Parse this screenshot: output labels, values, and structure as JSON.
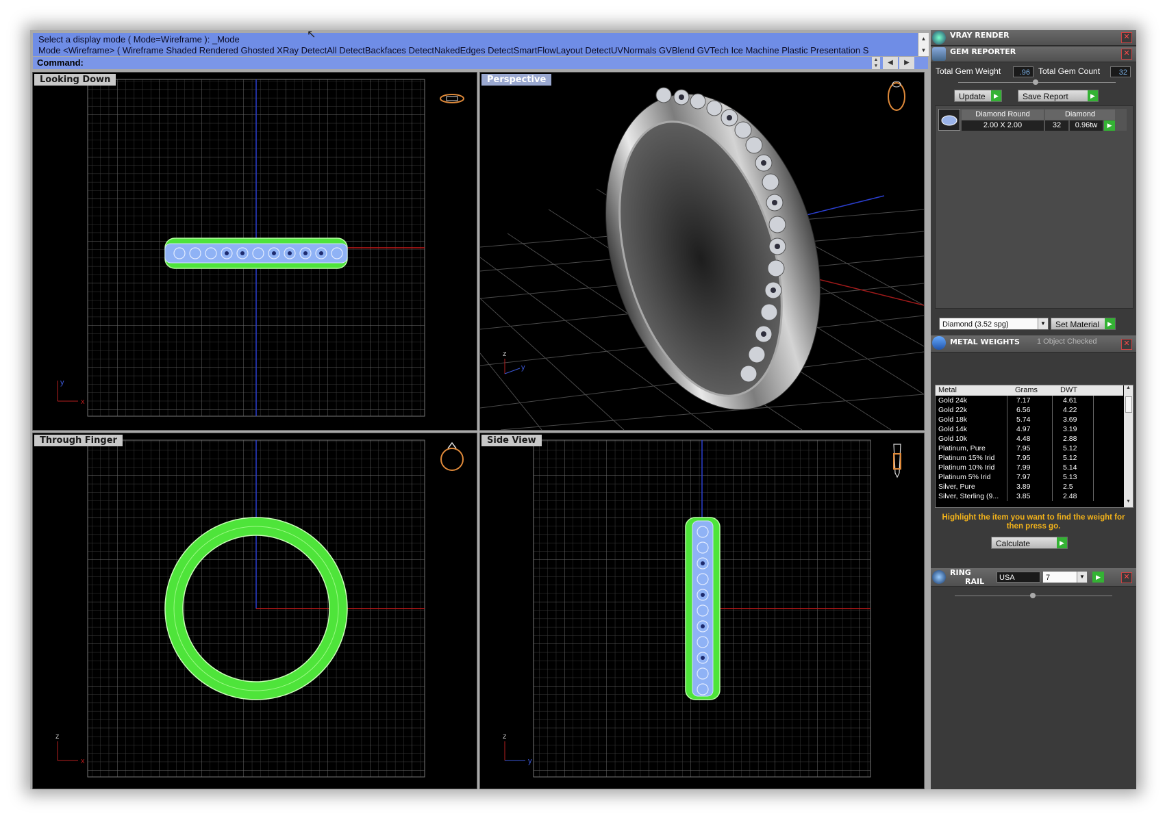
{
  "command": {
    "history_line1": "Select a display mode ( Mode=Wireframe ): _Mode",
    "history_line2": "Mode <Wireframe> ( Wireframe  Shaded  Rendered  Ghosted  XRay  DetectAll  DetectBackfaces  DetectNakedEdges  DetectSmartFlowLayout  DetectUVNormals  GVBlend  GVTech  Ice  Machine  Plastic  Presentation  S",
    "label": "Command:",
    "value": ""
  },
  "viewports": [
    {
      "label": "Looking Down",
      "axis_v": "y",
      "axis_h": "x"
    },
    {
      "label": "Perspective",
      "axis_v": "z",
      "axis_h": "y"
    },
    {
      "label": "Through Finger",
      "axis_v": "z",
      "axis_h": "x"
    },
    {
      "label": "Side View",
      "axis_v": "z",
      "axis_h": "y"
    }
  ],
  "panel": {
    "vray": {
      "title": "VRAY RENDER"
    },
    "gem": {
      "title": "GEM REPORTER",
      "total_weight_label": "Total Gem Weight",
      "total_weight_value": ".96",
      "total_count_label": "Total Gem Count",
      "total_count_value": "32",
      "update_label": "Update",
      "save_label": "Save Report",
      "row": {
        "shape": "Diamond Round",
        "size": "2.00 X 2.00",
        "material": "Diamond",
        "count": "32",
        "weight": "0.96tw"
      },
      "material_select": "Diamond    (3.52 spg)",
      "set_material_label": "Set Material"
    },
    "metal": {
      "title": "METAL WEIGHTS",
      "status": "1 Object Checked",
      "columns": [
        "Metal",
        "Grams",
        "DWT"
      ],
      "rows": [
        {
          "metal": "Gold 24k",
          "grams": "7.17",
          "dwt": "4.61"
        },
        {
          "metal": "Gold 22k",
          "grams": "6.56",
          "dwt": "4.22"
        },
        {
          "metal": "Gold 18k",
          "grams": "5.74",
          "dwt": "3.69"
        },
        {
          "metal": "Gold 14k",
          "grams": "4.97",
          "dwt": "3.19"
        },
        {
          "metal": "Gold 10k",
          "grams": "4.48",
          "dwt": "2.88"
        },
        {
          "metal": "Platinum, Pure",
          "grams": "7.95",
          "dwt": "5.12"
        },
        {
          "metal": "Platinum 15% Irid",
          "grams": "7.95",
          "dwt": "5.12"
        },
        {
          "metal": "Platinum 10% Irid",
          "grams": "7.99",
          "dwt": "5.14"
        },
        {
          "metal": "Platinum 5% Irid",
          "grams": "7.97",
          "dwt": "5.13"
        },
        {
          "metal": "Silver, Pure",
          "grams": "3.89",
          "dwt": "2.5"
        },
        {
          "metal": "Silver, Sterling (9...",
          "grams": "3.85",
          "dwt": "2.48"
        }
      ],
      "note": "Highlight the item you want to find the weight for then press go.",
      "calculate_label": "Calculate"
    },
    "ring": {
      "title_line1": "RING",
      "title_line2": "RAIL",
      "region": "USA",
      "size": "7"
    }
  },
  "colors": {
    "command_bg": "#6f8de6",
    "wire_green": "#5cf23e",
    "stone_blue": "#7fa4ef",
    "accent_green": "#34b234",
    "note_orange": "#f3b31a"
  }
}
